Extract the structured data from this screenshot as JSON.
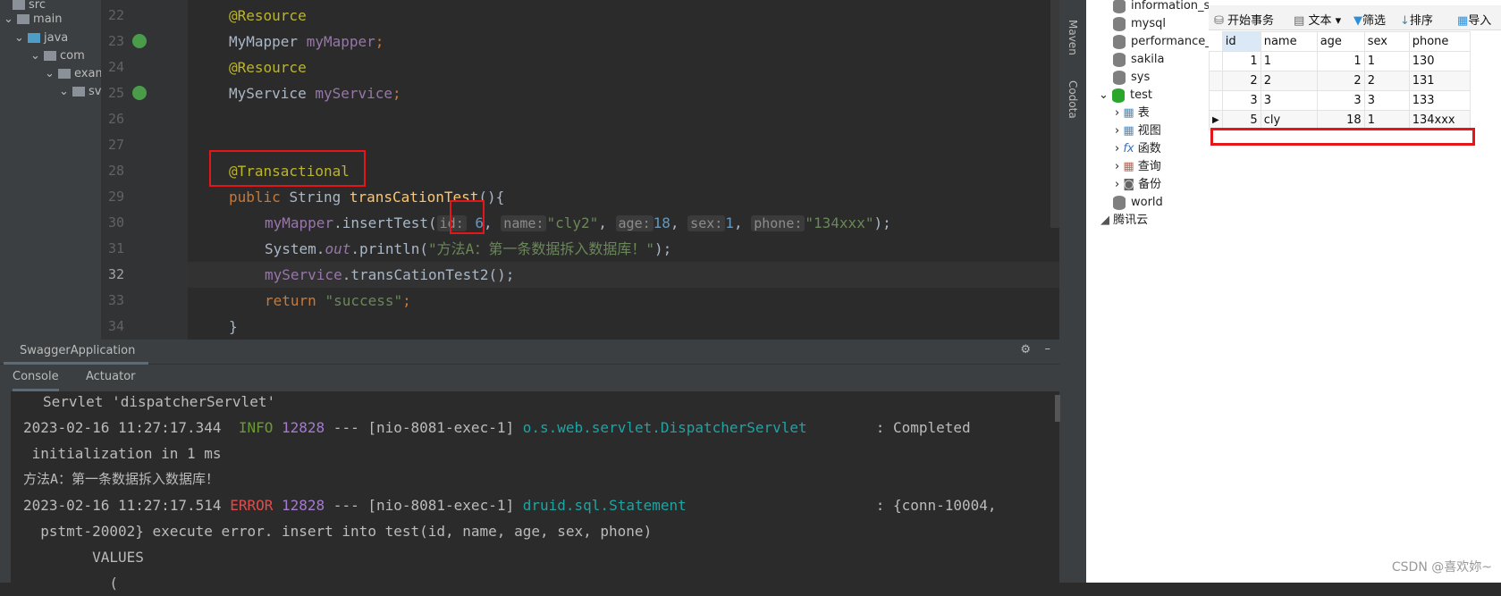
{
  "project_tree": {
    "items": [
      {
        "label": "src"
      },
      {
        "label": "main"
      },
      {
        "label": "java"
      },
      {
        "label": "com"
      },
      {
        "label": "exam"
      },
      {
        "label": "sv"
      }
    ]
  },
  "editor": {
    "line_numbers": [
      "22",
      "23",
      "24",
      "25",
      "26",
      "27",
      "28",
      "29",
      "30",
      "31",
      "32",
      "33",
      "34"
    ],
    "lines": {
      "l22": "@Resource",
      "l23a": "MyMapper ",
      "l23b": "myMapper",
      "l24": "@Resource",
      "l25a": "MyService ",
      "l25b": "myService",
      "l28": "@Transactional",
      "l29a": "public ",
      "l29b": "String ",
      "l29c": "transCationTest",
      "l29d": "(){",
      "l30a": "myMapper",
      "l30b": ".insertTest(",
      "h_id": "id:",
      "v_id": "6",
      "h_name": "name:",
      "v_name": "\"cly2\"",
      "h_age": "age:",
      "v_age": "18",
      "h_sex": "sex:",
      "v_sex": "1",
      "h_phone": "phone:",
      "v_phone": "\"134xxx\"",
      "l30e": ");",
      "l31a": "System.",
      "l31b": "out",
      "l31c": ".println(",
      "l31d": "\"方法A：第一条数据拆入数据库！\"",
      "l31e": ");",
      "l32a": "myService",
      "l32b": ".transCationTest2();",
      "l33a": "return ",
      "l33b": "\"success\"",
      "l34": "}"
    }
  },
  "side_tools": {
    "maven": "Maven",
    "codota": "Codota"
  },
  "run_panel": {
    "tab": "SwaggerApplication",
    "subtabs": [
      "Console",
      "Actuator"
    ],
    "console": {
      "c1": "Servlet 'dispatcherServlet'",
      "c2a": "2023-02-16 11:27:17.344  ",
      "c2b": "INFO",
      "c2c": "12828",
      "c2d": " --- [nio-8081-exec-1] ",
      "c2e": "o.s.web.servlet.DispatcherServlet",
      "c2f": "        : Completed",
      "c3": " initialization in 1 ms",
      "c4": "方法A：第一条数据拆入数据库！",
      "c5a": "2023-02-16 11:27:17.514 ",
      "c5b": "ERROR",
      "c5c": "12828",
      "c5d": " --- [nio-8081-exec-1] ",
      "c5e": "druid.sql.Statement",
      "c5f": "                      : {conn-10004,",
      "c6": "  pstmt-20002} execute error. insert into test(id, name, age, sex, phone)",
      "c7": "        VALUES",
      "c8": "          ("
    }
  },
  "navicat": {
    "tree": [
      "information_sc",
      "mysql",
      "performance_s",
      "sakila",
      "sys",
      "test",
      "表",
      "视图",
      "函数",
      "查询",
      "备份",
      "world",
      "腾讯云"
    ],
    "toolbar": [
      "开始事务",
      "文本",
      "筛选",
      "排序",
      "导入"
    ],
    "columns": [
      "id",
      "name",
      "age",
      "sex",
      "phone"
    ],
    "rows": [
      [
        "1",
        "1",
        "1",
        "1",
        "130"
      ],
      [
        "2",
        "2",
        "2",
        "2",
        "131"
      ],
      [
        "3",
        "3",
        "3",
        "3",
        "133"
      ],
      [
        "5",
        "cly",
        "18",
        "1",
        "134xxx"
      ]
    ]
  },
  "watermark": "CSDN @喜欢妳~"
}
